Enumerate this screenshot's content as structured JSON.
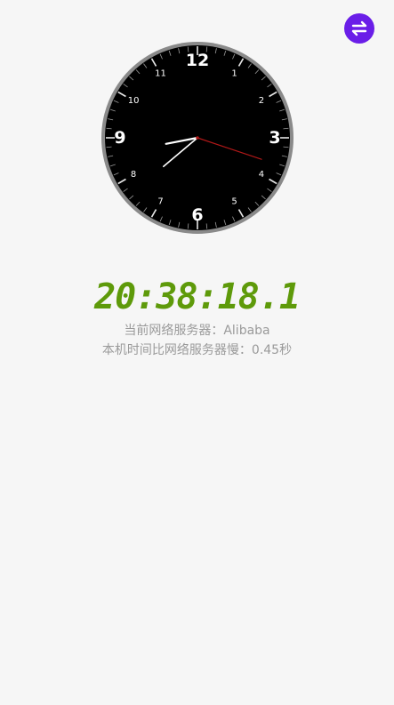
{
  "header": {
    "switch_icon": "swap-arrows-icon",
    "accent_color": "#6a1ee8"
  },
  "clock": {
    "face_color": "#000000",
    "ring_color": "#8a8a8a",
    "numerals": [
      {
        "label": "12",
        "major": true,
        "pos": 12
      },
      {
        "label": "1",
        "major": false,
        "pos": 1
      },
      {
        "label": "2",
        "major": false,
        "pos": 2
      },
      {
        "label": "3",
        "major": true,
        "pos": 3
      },
      {
        "label": "4",
        "major": false,
        "pos": 4
      },
      {
        "label": "5",
        "major": false,
        "pos": 5
      },
      {
        "label": "6",
        "major": true,
        "pos": 6
      },
      {
        "label": "7",
        "major": false,
        "pos": 7
      },
      {
        "label": "8",
        "major": false,
        "pos": 8
      },
      {
        "label": "9",
        "major": true,
        "pos": 9
      },
      {
        "label": "10",
        "major": false,
        "pos": 10
      },
      {
        "label": "11",
        "major": false,
        "pos": 11
      }
    ],
    "time": {
      "hours": 20,
      "minutes": 38,
      "seconds": 18.1
    },
    "hand_color": "#ffffff",
    "second_hand_color": "#b01818"
  },
  "digital": {
    "time_text": "20:38:18.1",
    "color": "#5e9a0a"
  },
  "info": {
    "server_text": "当前网络服务器：Alibaba",
    "offset_text": "本机时间比网络服务器慢：0.45秒"
  }
}
